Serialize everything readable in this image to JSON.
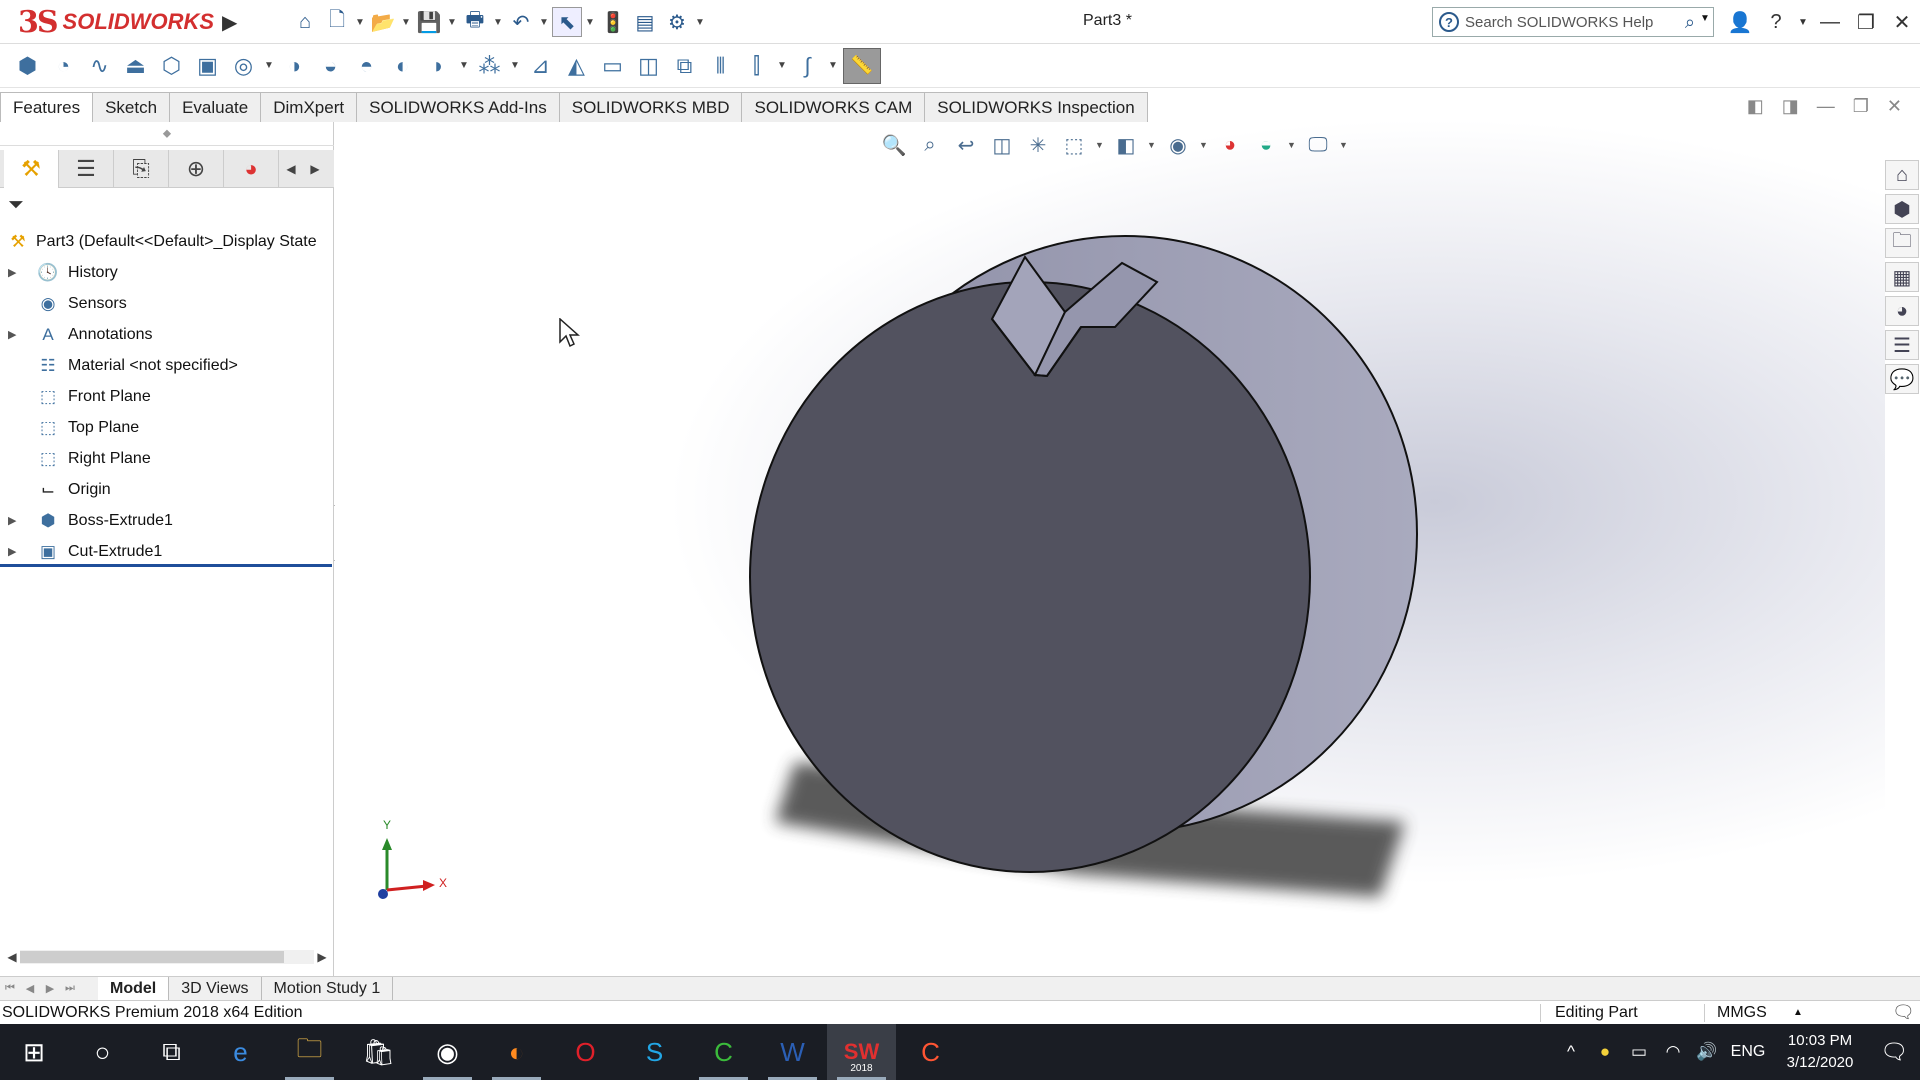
{
  "app": {
    "brand": "SOLIDWORKS",
    "document_title": "Part3 *"
  },
  "help_search": {
    "placeholder": "Search SOLIDWORKS Help"
  },
  "tabs": [
    {
      "label": "Features",
      "active": true
    },
    {
      "label": "Sketch",
      "active": false
    },
    {
      "label": "Evaluate",
      "active": false
    },
    {
      "label": "DimXpert",
      "active": false
    },
    {
      "label": "SOLIDWORKS Add-Ins",
      "active": false
    },
    {
      "label": "SOLIDWORKS MBD",
      "active": false
    },
    {
      "label": "SOLIDWORKS CAM",
      "active": false
    },
    {
      "label": "SOLIDWORKS Inspection",
      "active": false
    }
  ],
  "feature_tree": {
    "root_label": "Part3  (Default<<Default>_Display State",
    "items": [
      {
        "label": "History",
        "icon": "history-icon",
        "expandable": true
      },
      {
        "label": "Sensors",
        "icon": "sensors-icon",
        "expandable": false
      },
      {
        "label": "Annotations",
        "icon": "annotations-icon",
        "expandable": true
      },
      {
        "label": "Material <not specified>",
        "icon": "material-icon",
        "expandable": false
      },
      {
        "label": "Front Plane",
        "icon": "plane-icon",
        "expandable": false
      },
      {
        "label": "Top Plane",
        "icon": "plane-icon",
        "expandable": false
      },
      {
        "label": "Right Plane",
        "icon": "plane-icon",
        "expandable": false
      },
      {
        "label": "Origin",
        "icon": "origin-icon",
        "expandable": false
      },
      {
        "label": "Boss-Extrude1",
        "icon": "boss-extrude-icon",
        "expandable": true
      },
      {
        "label": "Cut-Extrude1",
        "icon": "cut-extrude-icon",
        "expandable": true
      }
    ]
  },
  "triad": {
    "x": "X",
    "y": "Y"
  },
  "model_tabs": [
    {
      "label": "Model",
      "active": true
    },
    {
      "label": "3D Views",
      "active": false
    },
    {
      "label": "Motion Study 1",
      "active": false
    }
  ],
  "status": {
    "edition": "SOLIDWORKS Premium 2018 x64 Edition",
    "mode": "Editing Part",
    "units": "MMGS"
  },
  "taskbar": {
    "apps": [
      "cortana-icon",
      "task-view-icon",
      "edge-icon",
      "file-explorer-icon",
      "store-icon",
      "chrome-icon",
      "firefox-icon",
      "opera-icon",
      "skype-icon",
      "camtasia-icon",
      "word-icon",
      "solidworks-icon",
      "camtasia-recorder-icon"
    ],
    "solidworks_badge": "2018",
    "language": "ENG",
    "time": "10:03 PM",
    "date": "3/12/2020"
  },
  "colors": {
    "brand_red": "#d32f2f",
    "part_face": "#52525f",
    "part_side": "#9a9bb0",
    "rollback_bar": "#1f4e9a",
    "taskbar_bg": "#1a1d24"
  }
}
